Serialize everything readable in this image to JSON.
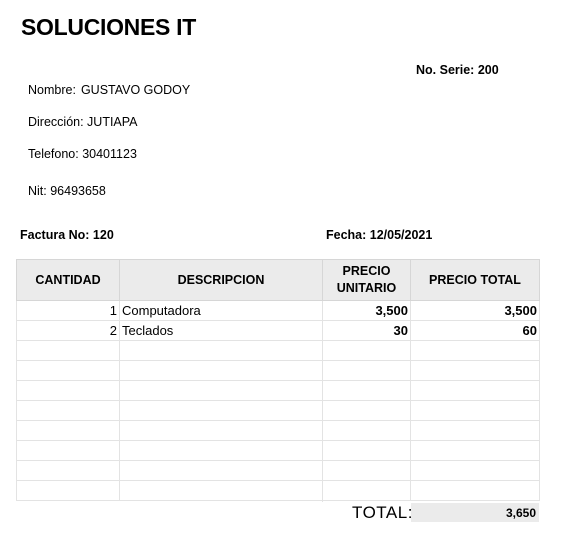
{
  "company": "SOLUCIONES IT",
  "serie": "No. Serie: 200",
  "customer": {
    "nombre_label": "Nombre:",
    "nombre_value": "GUSTAVO GODOY",
    "direccion": "Dirección: JUTIAPA",
    "telefono": "Telefono: 30401123",
    "nit": "Nit: 96493658"
  },
  "factura": "Factura No: 120",
  "fecha": "Fecha: 12/05/2021",
  "table": {
    "headers": {
      "cantidad": "CANTIDAD",
      "descripcion": "DESCRIPCION",
      "precio_unitario_1": "PRECIO",
      "precio_unitario_2": "UNITARIO",
      "precio_total": "PRECIO TOTAL"
    },
    "rows": [
      {
        "cantidad": "1",
        "descripcion": "Computadora",
        "precio_unitario": "3,500",
        "precio_total": "3,500"
      },
      {
        "cantidad": "2",
        "descripcion": "Teclados",
        "precio_unitario": "30",
        "precio_total": "60"
      }
    ]
  },
  "total_label": "TOTAL:",
  "total_value": "3,650"
}
